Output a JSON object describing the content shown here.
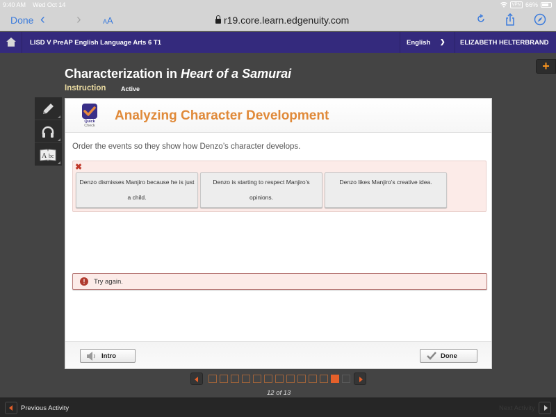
{
  "status_bar": {
    "time": "9:40 AM",
    "date": "Wed Oct 14",
    "vpn": "VPN",
    "battery": "66%"
  },
  "browser": {
    "done_label": "Done",
    "back_glyph": "‹",
    "forward_glyph": "›",
    "text_size_label": "AA",
    "url": "r19.core.learn.edgenuity.com",
    "icons": [
      "reload-icon",
      "share-icon",
      "compass-icon"
    ]
  },
  "top_nav": {
    "course": "LISD V PreAP English Language Arts 6 T1",
    "language": "English",
    "user": "ELIZABETH HELTERBRAND"
  },
  "lesson": {
    "title_prefix": "Characterization in ",
    "title_italic": "Heart of a Samurai",
    "tab_instruction": "Instruction",
    "tab_status": "Active"
  },
  "tools": [
    "pencil-icon",
    "headphones-icon",
    "dictionary-icon"
  ],
  "quick_check": {
    "line1": "Quick",
    "line2": "Check"
  },
  "activity": {
    "title": "Analyzing Character Development",
    "prompt": "Order the events so they show how Denzo’s character develops.",
    "cards": [
      "Denzo dismisses Manjiro because he is just a child.",
      "Denzo is starting to respect Manjiro’s opinions.",
      "Denzo likes Manjiro’s creative idea."
    ],
    "feedback": "Try again.",
    "intro_button": "Intro",
    "done_button": "Done"
  },
  "pager": {
    "total": 13,
    "current": 12,
    "completed": 11,
    "label": "12 of 13"
  },
  "footer": {
    "previous": "Previous Activity",
    "next": "Next Activity"
  },
  "colors": {
    "nav": "#342a7d",
    "accent": "#e08a3a",
    "current_page": "#e5602a",
    "error": "#b03a2e"
  }
}
